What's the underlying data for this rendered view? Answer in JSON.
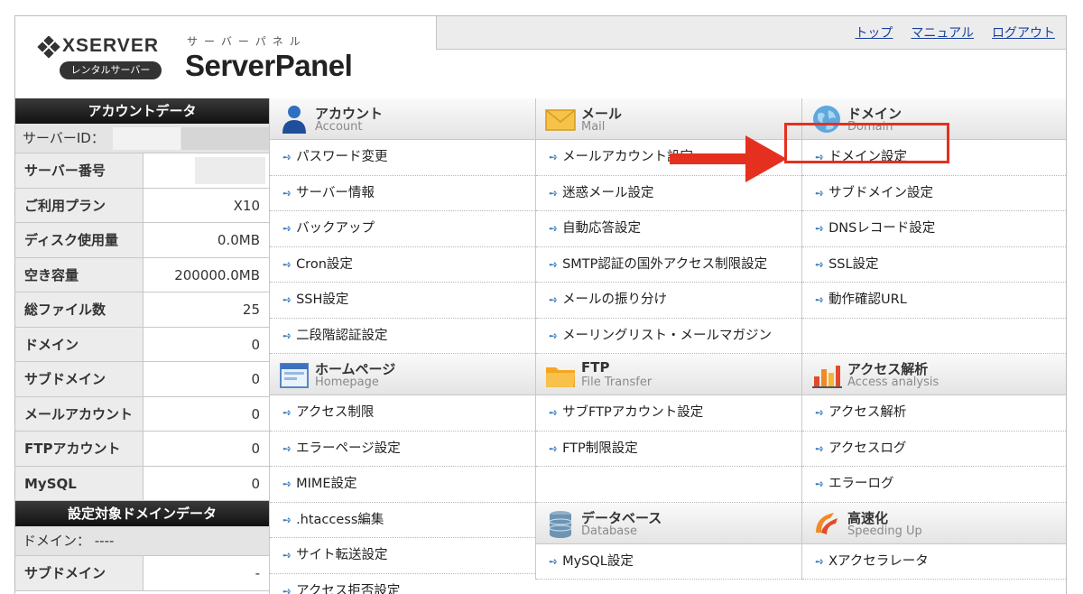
{
  "header": {
    "brand": "XSERVER",
    "brand_badge": "レンタルサーバー",
    "panel_kana": "サーバーパネル",
    "panel_title": "ServerPanel",
    "links": [
      "トップ",
      "マニュアル",
      "ログアウト"
    ]
  },
  "account": {
    "title": "アカウントデータ",
    "server_id_label": "サーバーID：",
    "rows": [
      {
        "label": "サーバー番号",
        "value": ""
      },
      {
        "label": "ご利用プラン",
        "value": "X10"
      },
      {
        "label": "ディスク使用量",
        "value": "0.0MB"
      },
      {
        "label": "空き容量",
        "value": "200000.0MB"
      },
      {
        "label": "総ファイル数",
        "value": "25"
      },
      {
        "label": "ドメイン",
        "value": "0"
      },
      {
        "label": "サブドメイン",
        "value": "0"
      },
      {
        "label": "メールアカウント",
        "value": "0"
      },
      {
        "label": "FTPアカウント",
        "value": "0"
      },
      {
        "label": "MySQL",
        "value": "0"
      }
    ]
  },
  "domain_data": {
    "title": "設定対象ドメインデータ",
    "domain_label": "ドメイン： ----",
    "rows": [
      {
        "label": "サブドメイン",
        "value": "-"
      }
    ]
  },
  "menu": {
    "account": {
      "title_ja": "アカウント",
      "title_en": "Account",
      "items": [
        "パスワード変更",
        "サーバー情報",
        "バックアップ",
        "Cron設定",
        "SSH設定",
        "二段階認証設定"
      ]
    },
    "homepage": {
      "title_ja": "ホームページ",
      "title_en": "Homepage",
      "items": [
        "アクセス制限",
        "エラーページ設定",
        "MIME設定",
        ".htaccess編集",
        "サイト転送設定",
        "アクセス拒否設定"
      ]
    },
    "mail": {
      "title_ja": "メール",
      "title_en": "Mail",
      "items": [
        "メールアカウント設定",
        "迷惑メール設定",
        "自動応答設定",
        "SMTP認証の国外アクセス制限設定",
        "メールの振り分け",
        "メーリングリスト・メールマガジン"
      ]
    },
    "ftp": {
      "title_ja": "FTP",
      "title_en": "File Transfer",
      "items": [
        "サブFTPアカウント設定",
        "FTP制限設定"
      ]
    },
    "database": {
      "title_ja": "データベース",
      "title_en": "Database",
      "items": [
        "MySQL設定"
      ]
    },
    "domain": {
      "title_ja": "ドメイン",
      "title_en": "Domain",
      "items": [
        "ドメイン設定",
        "サブドメイン設定",
        "DNSレコード設定",
        "SSL設定",
        "動作確認URL"
      ]
    },
    "access": {
      "title_ja": "アクセス解析",
      "title_en": "Access analysis",
      "items": [
        "アクセス解析",
        "アクセスログ",
        "エラーログ"
      ]
    },
    "speed": {
      "title_ja": "高速化",
      "title_en": "Speeding Up",
      "items": [
        "Xアクセラレータ"
      ]
    }
  },
  "colors": {
    "highlight": "#e53020",
    "link": "#1a3f9c",
    "item_arrow": "#3a7bbf"
  }
}
